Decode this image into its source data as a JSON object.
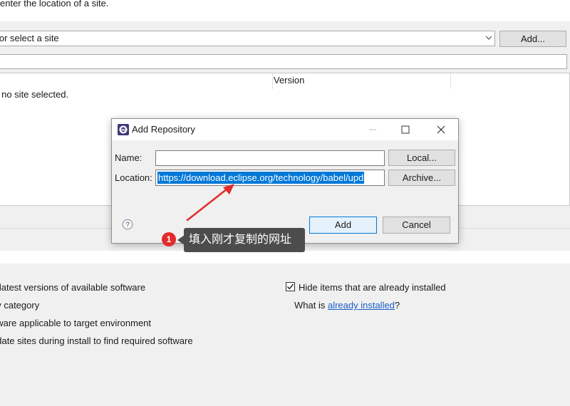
{
  "page": {
    "instruction": "enter the location of a site.",
    "site_combo_text": "e or select a site",
    "add_site_button": "Add...",
    "tree_header_version": "Version",
    "no_site_text": "s no site selected.",
    "options": [
      "e latest versions of available software",
      "by category",
      "ftware applicable to target environment",
      "odate sites during install to find required software"
    ],
    "hide_installed_label": "Hide items that are already installed",
    "hide_installed_checked": true,
    "whatis_prefix": "What is ",
    "whatis_link": "already installed",
    "whatis_suffix": "?"
  },
  "dialog": {
    "title": "Add Repository",
    "name_label": "Name:",
    "name_value": "",
    "local_button": "Local...",
    "location_label": "Location:",
    "location_value": "https://download.eclipse.org/technology/babel/upd",
    "archive_button": "Archive...",
    "add_button": "Add",
    "cancel_button": "Cancel"
  },
  "annotation": {
    "badge": "1",
    "text": "填入刚才复制的网址"
  },
  "colors": {
    "selection": "#0078d7",
    "link": "#1a5ec7",
    "annotation_red": "#e32b2b",
    "annotation_bubble": "#4c4c4c"
  },
  "icons": [
    "chevron-down-icon",
    "eclipse-app-icon",
    "minimize-icon",
    "maximize-icon",
    "close-icon",
    "help-icon",
    "checkmark-icon",
    "arrow-annotation-icon"
  ]
}
